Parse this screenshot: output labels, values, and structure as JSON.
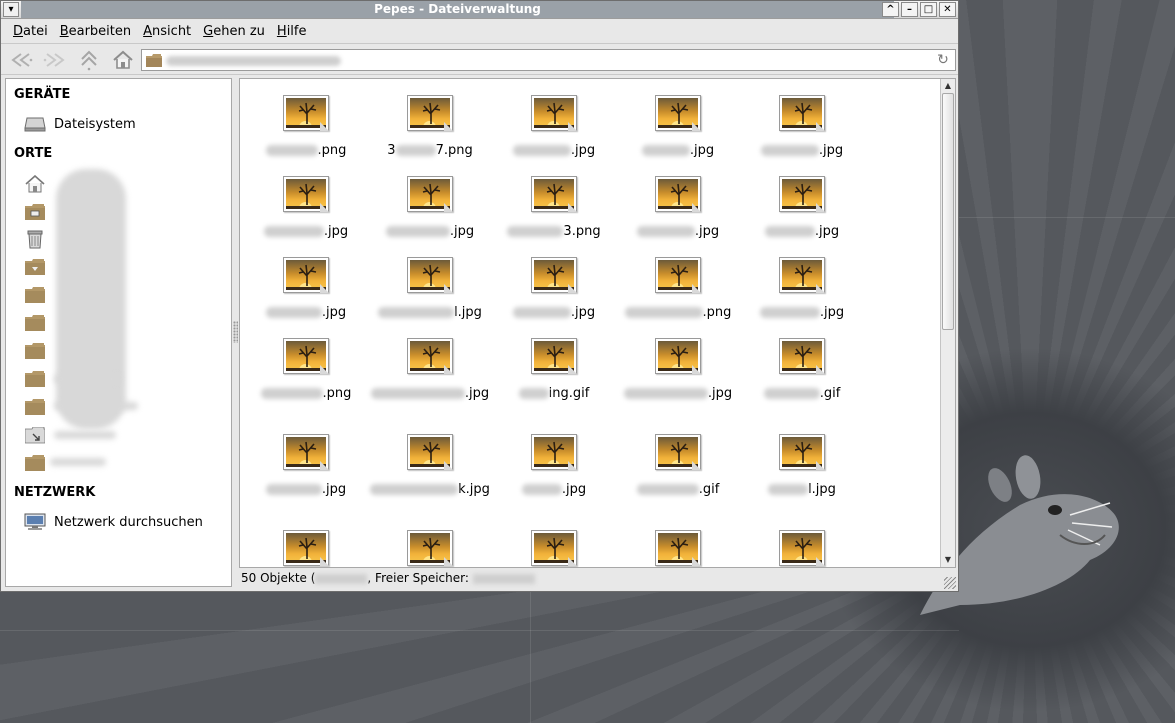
{
  "window": {
    "title": "Pepes - Dateiverwaltung"
  },
  "titlebar_buttons": [
    "^",
    "–",
    "□",
    "✕"
  ],
  "menubar": {
    "items": [
      {
        "label": "Datei"
      },
      {
        "label": "Bearbeiten"
      },
      {
        "label": "Ansicht"
      },
      {
        "label": "Gehen zu"
      },
      {
        "label": "Hilfe"
      }
    ]
  },
  "toolbar": {
    "back": "back-icon",
    "forward": "forward-icon",
    "up": "up-icon",
    "home": "home-icon",
    "location_value": "",
    "reload": "reload-icon"
  },
  "sidebar": {
    "devices_title": "GERÄTE",
    "devices": [
      {
        "label": "Dateisystem",
        "icon": "drive-icon"
      }
    ],
    "places_title": "ORTE",
    "places_icons": [
      "home-icon",
      "desktop-folder-icon",
      "trash-icon",
      "download-folder-icon",
      "folder-icon",
      "folder-icon",
      "folder-icon",
      "folder-icon",
      "folder-icon",
      "link-folder-icon",
      "folder-icon"
    ],
    "network_title": "NETZWERK",
    "network": [
      {
        "label": "Netzwerk durchsuchen",
        "icon": "network-icon"
      }
    ]
  },
  "files": {
    "rows": [
      [
        {
          "name": ".png"
        },
        {
          "name": "7.png",
          "prefix": "3"
        },
        {
          "name": ".jpg"
        },
        {
          "name": ".jpg"
        },
        {
          "name": ".jpg"
        }
      ],
      [
        {
          "name": ".jpg"
        },
        {
          "name": ".jpg"
        },
        {
          "name": "3.png"
        },
        {
          "name": ".jpg"
        },
        {
          "name": ".jpg"
        }
      ],
      [
        {
          "name": ".jpg"
        },
        {
          "name": "l.jpg"
        },
        {
          "name": ".jpg"
        },
        {
          "name": ".png"
        },
        {
          "name": ".jpg"
        }
      ],
      [
        {
          "name": ".png"
        },
        {
          "name": ".jpg"
        },
        {
          "name": "ing.gif"
        },
        {
          "name": ".jpg"
        },
        {
          "name": ".gif"
        }
      ],
      [
        {
          "name": ".jpg"
        },
        {
          "name": "k.jpg"
        },
        {
          "name": ".jpg"
        },
        {
          "name": ".gif"
        },
        {
          "name": "l.jpg"
        }
      ],
      [
        {
          "name": ""
        },
        {
          "name": ""
        },
        {
          "name": ""
        },
        {
          "name": ""
        },
        {
          "name": ""
        }
      ]
    ]
  },
  "statusbar": {
    "prefix": "50 Objekte (",
    "middle": ", Freier Speicher: "
  }
}
